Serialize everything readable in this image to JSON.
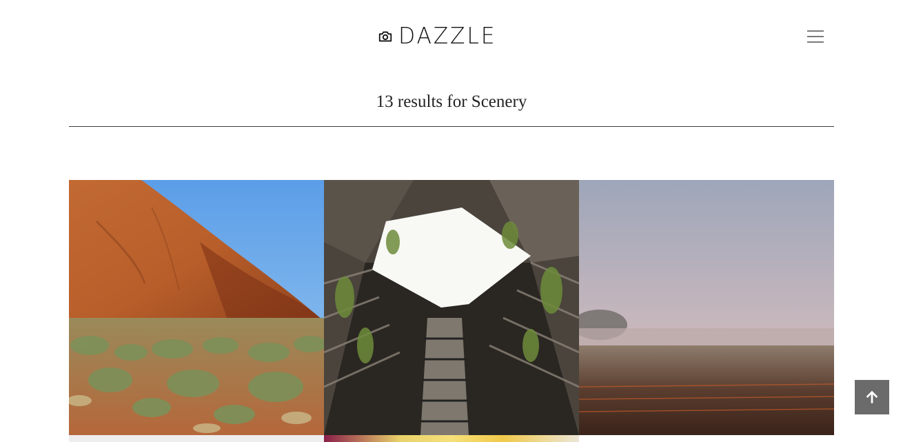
{
  "brand": {
    "name": "DAZZLE",
    "icon": "camera-icon"
  },
  "header": {
    "menu_icon": "hamburger-menu-icon"
  },
  "search": {
    "results_text": "13 results for Scenery"
  },
  "gallery": {
    "items": [
      {
        "subject": "red rock desert with shrubs"
      },
      {
        "subject": "looking up a courtyard tower with plants"
      },
      {
        "subject": "misty field at dusk"
      },
      {
        "subject": "partially visible image"
      },
      {
        "subject": "partially visible image"
      }
    ]
  },
  "back_to_top": {
    "icon": "arrow-up-icon"
  },
  "colors": {
    "text": "#222222",
    "divider": "#3a3a3a",
    "back_to_top_bg": "#6b6b6b"
  }
}
